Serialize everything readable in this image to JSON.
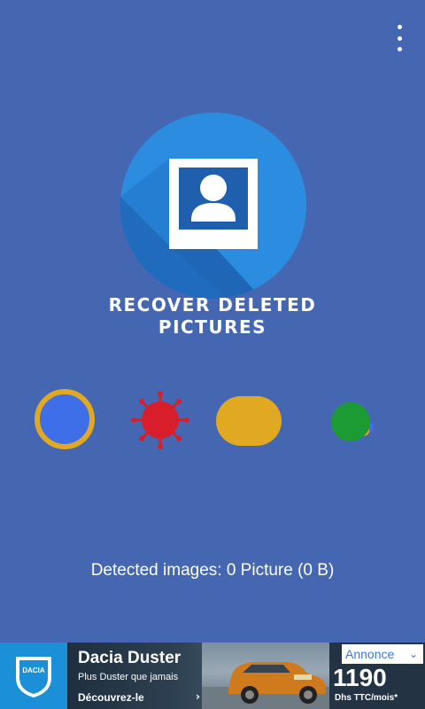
{
  "app": {
    "title": "RECOVER DELETED PICTURES",
    "title_line1": "RECOVER DELETED",
    "title_line2": "PICTURES",
    "status_text": "Detected images: 0 Picture (0 B)"
  },
  "icons": {
    "menu": "more-vertical-icon",
    "logo": "photo-portrait-icon"
  },
  "colors": {
    "background": "#4566B0",
    "logo_circle": "#2B8CE0",
    "dot_blue": "#3F6FE8",
    "dot_gold": "#E1A821",
    "dot_red": "#D81E2A",
    "dot_green": "#1C9A33"
  },
  "ad": {
    "brand": "DACIA",
    "title": "Dacia Duster",
    "subtitle": "Plus Duster que jamais",
    "cta": "Découvrez-le",
    "cta_arrow": "›",
    "label": "Annonce",
    "price": "1190",
    "price_note": "Dhs TTC/mois*"
  }
}
